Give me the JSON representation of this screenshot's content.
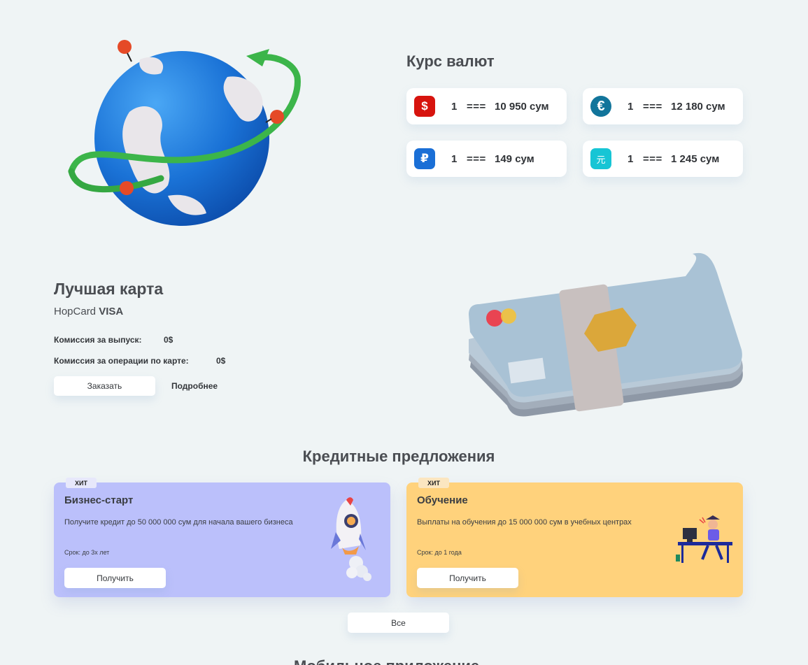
{
  "rates": {
    "title": "Курс валют",
    "items": [
      {
        "symbol": "$",
        "color": "#d7140e",
        "amount": "1",
        "eq": "===",
        "value": "10 950 сум",
        "icon": "dollar-icon"
      },
      {
        "symbol": "€",
        "color": "#12759b",
        "amount": "1",
        "eq": "===",
        "value": "12 180 сум",
        "icon": "euro-icon"
      },
      {
        "symbol": "₽",
        "color": "#1a6fd6",
        "amount": "1",
        "eq": "===",
        "value": "149 сум",
        "icon": "ruble-icon"
      },
      {
        "symbol": "元",
        "color": "#17c5d5",
        "amount": "1",
        "eq": "===",
        "value": "1 245 сум",
        "icon": "yuan-icon"
      }
    ]
  },
  "best_card": {
    "title": "Лучшая карта",
    "subtitle_plain": "HopCard",
    "subtitle_bold": "VISA",
    "issue_label": "Комиссия за выпуск:",
    "issue_value": "0$",
    "ops_label": "Комиссия за операции по карте:",
    "ops_value": "0$",
    "order_button": "Заказать",
    "more_link": "Подробнее"
  },
  "credit": {
    "title": "Кредитные предложения",
    "offers": [
      {
        "badge": "ХИТ",
        "title": "Бизнес-старт",
        "desc": "Получите кредит до 50 000 000 сум для начала вашего бизнеса",
        "term": "Срок: до 3х лет",
        "button": "Получить",
        "bg": "#bbc0fb",
        "badge_bg": "#e7e8fb"
      },
      {
        "badge": "ХИТ",
        "title": "Обучение",
        "desc": "Выплаты на обучения до 15 000 000 сум в учебных центрах",
        "term": "Срок: до 1 года",
        "button": "Получить",
        "bg": "#ffd27c",
        "badge_bg": "#fbe6c0"
      }
    ],
    "all_button": "Все"
  },
  "next_section_peek": "Мобильное приложение"
}
